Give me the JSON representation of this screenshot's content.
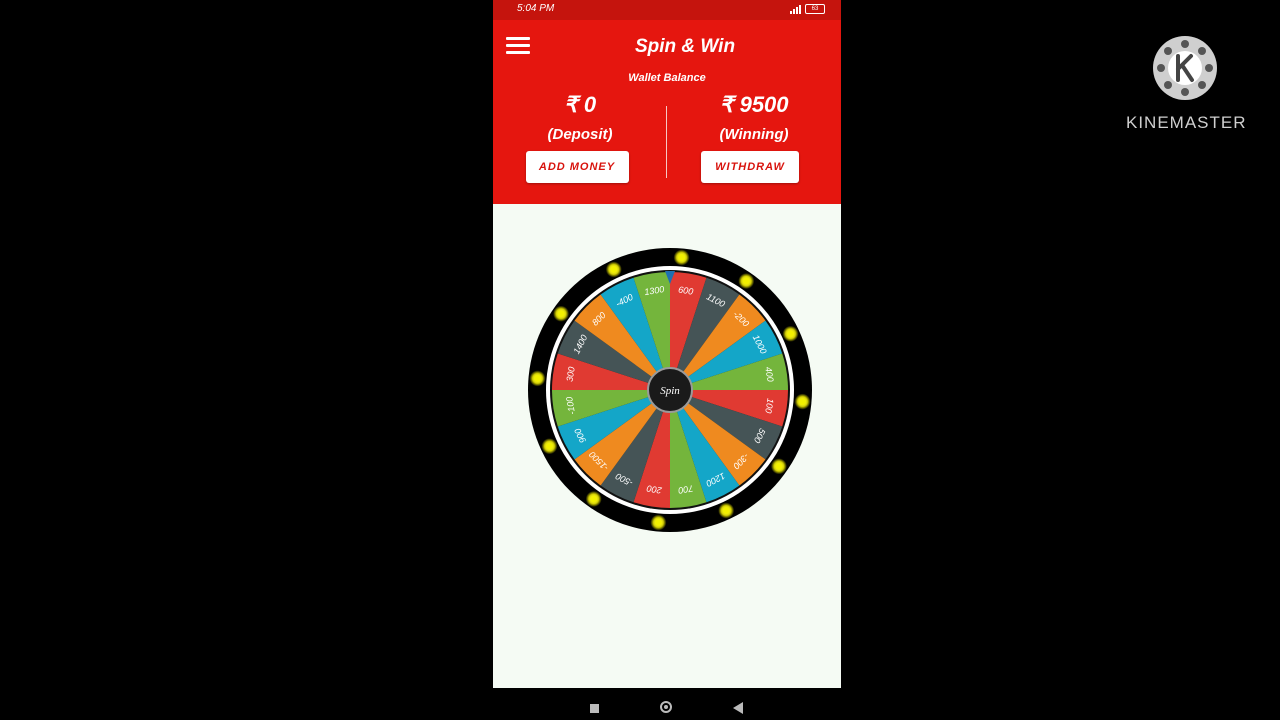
{
  "status_bar": {
    "time": "5:04 PM",
    "battery": "63"
  },
  "app_bar": {
    "title": "Spin & Win"
  },
  "wallet": {
    "label": "Wallet Balance",
    "deposit_amount": "₹ 0",
    "deposit_caption": "(Deposit)",
    "winning_amount": "₹ 9500",
    "winning_caption": "(Winning)",
    "add_money_label": "ADD MONEY",
    "withdraw_label": "WITHDRAW"
  },
  "wheel": {
    "center_label": "Spin",
    "segments": [
      "600",
      "1100",
      "-200",
      "1000",
      "400",
      "100",
      "500",
      "-300",
      "1200",
      "700",
      "200",
      "-500",
      "-1500",
      "900",
      "-100",
      "300",
      "1400",
      "800",
      "-400",
      "1300"
    ],
    "colors": {
      "red": "#e03a32",
      "dark": "#455456",
      "orange": "#ef8a1f",
      "blue": "#14a6c8",
      "green": "#74b53c"
    }
  },
  "watermark": {
    "text": "KINEMASTER"
  },
  "theme": {
    "primary": "#e5160f",
    "status": "#c5140d",
    "background": "#f5fbf4"
  }
}
